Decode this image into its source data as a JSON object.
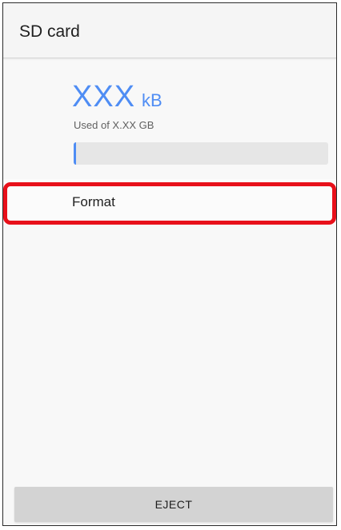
{
  "app_bar": {
    "title": "SD card"
  },
  "storage": {
    "used_amount": "XXX",
    "used_unit": "kB",
    "caption": "Used of X.XX GB",
    "used_fraction": 0.01
  },
  "menu": {
    "format_label": "Format"
  },
  "actions": {
    "eject_label": "EJECT"
  },
  "colors": {
    "accent": "#4f8df4",
    "highlight": "#e8101a",
    "button_bg": "#d3d3d3",
    "track": "#e6e6e6"
  }
}
